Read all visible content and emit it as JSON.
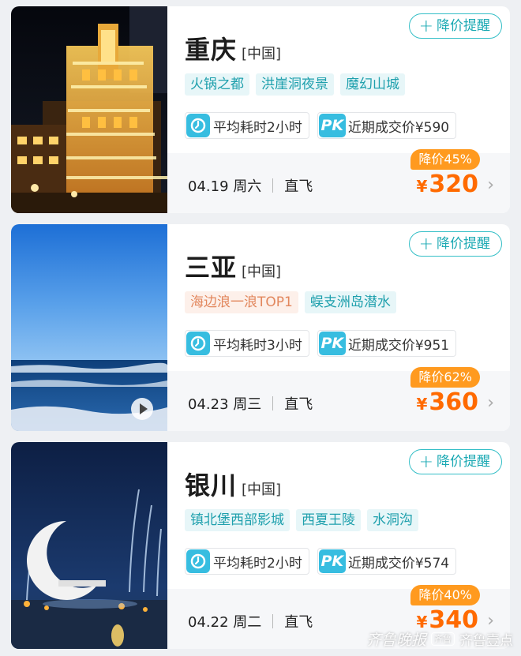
{
  "alert_label": "降价提醒",
  "plus_glyph": "+",
  "yen_symbol": "¥",
  "accent_color": "#1aa9b3",
  "price_color": "#ff6a00",
  "discount_color": "#ff9a1f",
  "cards": [
    {
      "city": "重庆",
      "country": "[中国]",
      "tags": [
        {
          "text": "火锅之都",
          "style": "normal"
        },
        {
          "text": "洪崖洞夜景",
          "style": "normal"
        },
        {
          "text": "魔幻山城",
          "style": "normal"
        }
      ],
      "duration": "平均耗时2小时",
      "pk_label": "PK",
      "recent_price": "近期成交价¥590",
      "date": "04.19 周六",
      "flight_type": "直飞",
      "discount": "降价45%",
      "price": "320",
      "photo": "chongqing-night-building",
      "has_video": false
    },
    {
      "city": "三亚",
      "country": "[中国]",
      "tags": [
        {
          "text": "海边浪一浪TOP1",
          "style": "hot"
        },
        {
          "text": "蜈支洲岛潜水",
          "style": "normal"
        }
      ],
      "duration": "平均耗时3小时",
      "pk_label": "PK",
      "recent_price": "近期成交价¥951",
      "date": "04.23 周三",
      "flight_type": "直飞",
      "discount": "降价62%",
      "price": "360",
      "photo": "sanya-sea-sky",
      "has_video": true
    },
    {
      "city": "银川",
      "country": "[中国]",
      "tags": [
        {
          "text": "镇北堡西部影城",
          "style": "normal"
        },
        {
          "text": "西夏王陵",
          "style": "normal"
        },
        {
          "text": "水洞沟",
          "style": "normal"
        }
      ],
      "duration": "平均耗时2小时",
      "pk_label": "PK",
      "recent_price": "近期成交价¥574",
      "date": "04.22 周二",
      "flight_type": "直飞",
      "discount": "降价40%",
      "price": "340",
      "photo": "yinchuan-moon-fountain",
      "has_video": false
    }
  ],
  "watermark": {
    "logo": "齐鲁晚报",
    "badge": "齐鲁",
    "text": "齐鲁壹点"
  }
}
